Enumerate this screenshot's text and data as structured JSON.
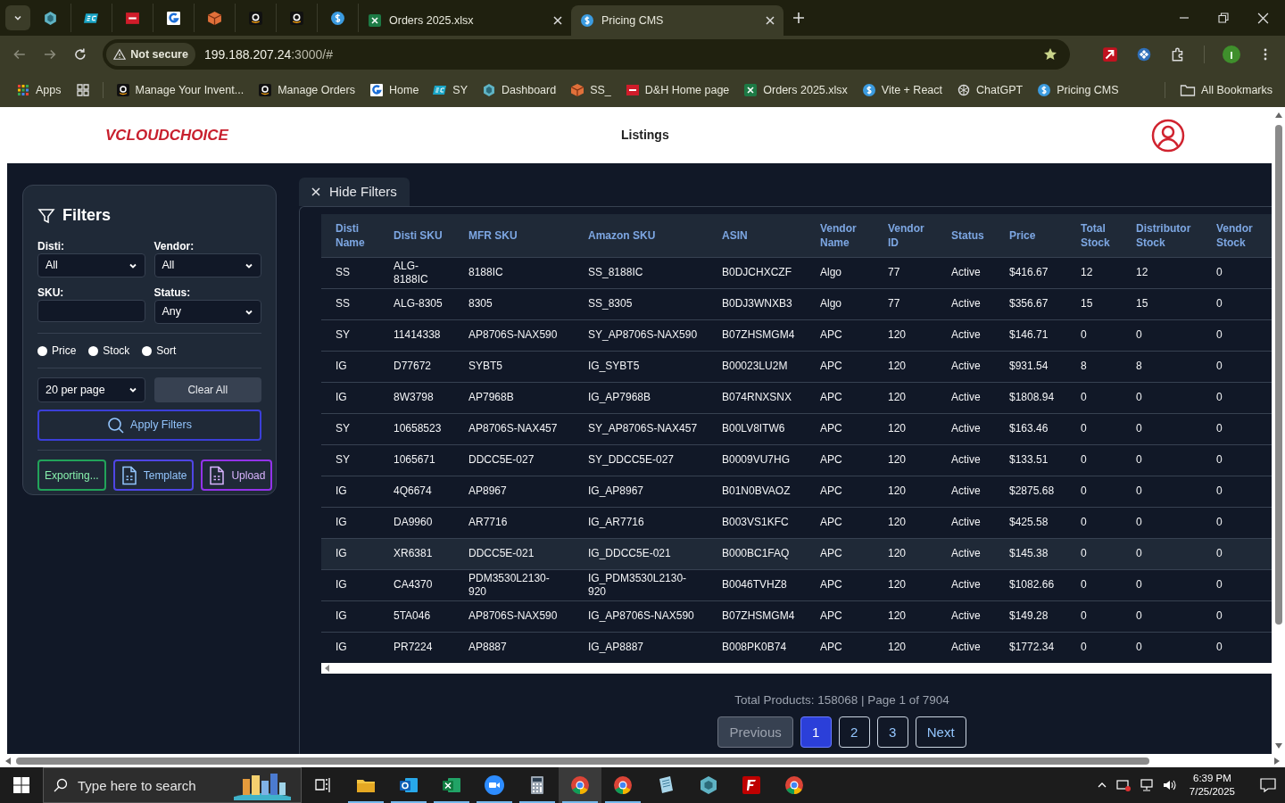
{
  "browser": {
    "tabs": [
      {
        "kind": "sheet",
        "title": "Orders 2025.xlsx",
        "selected": false
      },
      {
        "kind": "dollar",
        "title": "Pricing CMS",
        "selected": true
      }
    ],
    "address": {
      "warning": "Not secure",
      "host": "199.188.207.24",
      "path": ":3000/#"
    },
    "bookmarks": [
      {
        "kind": "apps",
        "label": "Apps"
      },
      {
        "kind": "amazon",
        "label": "Manage Your Invent..."
      },
      {
        "kind": "amazon",
        "label": "Manage Orders"
      },
      {
        "kind": "g",
        "label": "Home"
      },
      {
        "kind": "ec",
        "label": "SY"
      },
      {
        "kind": "hex",
        "label": "Dashboard"
      },
      {
        "kind": "box",
        "label": "SS_"
      },
      {
        "kind": "dh",
        "label": "D&H Home page"
      },
      {
        "kind": "sheet",
        "label": "Orders 2025.xlsx"
      },
      {
        "kind": "dollar",
        "label": "Vite + React"
      },
      {
        "kind": "openai",
        "label": "ChatGPT"
      },
      {
        "kind": "dollar",
        "label": "Pricing CMS"
      }
    ],
    "all_bookmarks": "All Bookmarks"
  },
  "app": {
    "logo": "VCLOUDCHOICE",
    "title": "Listings"
  },
  "filters": {
    "title": "Filters",
    "fields": [
      {
        "kind": "select",
        "label": "Disti:",
        "value": "All"
      },
      {
        "kind": "select",
        "label": "Vendor:",
        "value": "All"
      },
      {
        "kind": "input",
        "label": "SKU:"
      },
      {
        "kind": "select",
        "label": "Status:",
        "value": "Any"
      }
    ],
    "radios": [
      {
        "label": "Price",
        "checked": false
      },
      {
        "label": "Stock",
        "checked": false
      },
      {
        "label": "Sort",
        "checked": false
      }
    ],
    "per_page": "20 per page",
    "clear": "Clear All",
    "apply": "Apply Filters",
    "actions": [
      {
        "kind": "plain",
        "label": "Exporting...",
        "color": "#22a35a"
      },
      {
        "kind": "file",
        "label": "Template",
        "color": "#4f46e5"
      },
      {
        "kind": "file",
        "label": "Upload",
        "color": "#9333ea"
      }
    ]
  },
  "hide_filters": "Hide Filters",
  "table": {
    "columns": [
      "Disti Name",
      "Disti SKU",
      "MFR SKU",
      "Amazon SKU",
      "ASIN",
      "Vendor Name",
      "Vendor ID",
      "Status",
      "Price",
      "Total Stock",
      "Distributor Stock",
      "Vendor Stock"
    ],
    "rows": [
      {
        "selected": false,
        "cells": [
          "SS",
          "ALG-8188IC",
          "8188IC",
          "SS_8188IC",
          "B0DJCHXCZF",
          "Algo",
          "77",
          "Active",
          "$416.67",
          "12",
          "12",
          "0"
        ]
      },
      {
        "selected": false,
        "cells": [
          "SS",
          "ALG-8305",
          "8305",
          "SS_8305",
          "B0DJ3WNXB3",
          "Algo",
          "77",
          "Active",
          "$356.67",
          "15",
          "15",
          "0"
        ]
      },
      {
        "selected": false,
        "cells": [
          "SY",
          "11414338",
          "AP8706S-NAX590",
          "SY_AP8706S-NAX590",
          "B07ZHSMGM4",
          "APC",
          "120",
          "Active",
          "$146.71",
          "0",
          "0",
          "0"
        ]
      },
      {
        "selected": false,
        "cells": [
          "IG",
          "D77672",
          "SYBT5",
          "IG_SYBT5",
          "B00023LU2M",
          "APC",
          "120",
          "Active",
          "$931.54",
          "8",
          "8",
          "0"
        ]
      },
      {
        "selected": false,
        "cells": [
          "IG",
          "8W3798",
          "AP7968B",
          "IG_AP7968B",
          "B074RNXSNX",
          "APC",
          "120",
          "Active",
          "$1808.94",
          "0",
          "0",
          "0"
        ]
      },
      {
        "selected": false,
        "cells": [
          "SY",
          "10658523",
          "AP8706S-NAX457",
          "SY_AP8706S-NAX457",
          "B00LV8ITW6",
          "APC",
          "120",
          "Active",
          "$163.46",
          "0",
          "0",
          "0"
        ]
      },
      {
        "selected": false,
        "cells": [
          "SY",
          "1065671",
          "DDCC5E-027",
          "SY_DDCC5E-027",
          "B0009VU7HG",
          "APC",
          "120",
          "Active",
          "$133.51",
          "0",
          "0",
          "0"
        ]
      },
      {
        "selected": false,
        "cells": [
          "IG",
          "4Q6674",
          "AP8967",
          "IG_AP8967",
          "B01N0BVAOZ",
          "APC",
          "120",
          "Active",
          "$2875.68",
          "0",
          "0",
          "0"
        ]
      },
      {
        "selected": false,
        "cells": [
          "IG",
          "DA9960",
          "AR7716",
          "IG_AR7716",
          "B003VS1KFC",
          "APC",
          "120",
          "Active",
          "$425.58",
          "0",
          "0",
          "0"
        ]
      },
      {
        "selected": true,
        "cells": [
          "IG",
          "XR6381",
          "DDCC5E-021",
          "IG_DDCC5E-021",
          "B000BC1FAQ",
          "APC",
          "120",
          "Active",
          "$145.38",
          "0",
          "0",
          "0"
        ]
      },
      {
        "selected": false,
        "cells": [
          "IG",
          "CA4370",
          "PDM3530L2130-920",
          "IG_PDM3530L2130-920",
          "B0046TVHZ8",
          "APC",
          "120",
          "Active",
          "$1082.66",
          "0",
          "0",
          "0"
        ]
      },
      {
        "selected": false,
        "cells": [
          "IG",
          "5TA046",
          "AP8706S-NAX590",
          "IG_AP8706S-NAX590",
          "B07ZHSMGM4",
          "APC",
          "120",
          "Active",
          "$149.28",
          "0",
          "0",
          "0"
        ]
      },
      {
        "selected": false,
        "cells": [
          "IG",
          "PR7224",
          "AP8887",
          "IG_AP8887",
          "B008PK0B74",
          "APC",
          "120",
          "Active",
          "$1772.34",
          "0",
          "0",
          "0"
        ]
      }
    ]
  },
  "pagination": {
    "summary": "Total Products: 158068 | Page 1 of 7904",
    "buttons": [
      {
        "kind": "nav",
        "label": "Previous",
        "disabled": true,
        "selected": false
      },
      {
        "kind": "page",
        "label": "1",
        "disabled": false,
        "selected": true
      },
      {
        "kind": "page",
        "label": "2",
        "disabled": false,
        "selected": false
      },
      {
        "kind": "page",
        "label": "3",
        "disabled": false,
        "selected": false
      },
      {
        "kind": "nav",
        "label": "Next",
        "disabled": false,
        "selected": false
      }
    ]
  },
  "taskbar": {
    "search_placeholder": "Type here to search",
    "apps": [
      {
        "kind": "explorer",
        "running": true,
        "selected": false
      },
      {
        "kind": "outlook",
        "running": true,
        "selected": false
      },
      {
        "kind": "excel",
        "running": true,
        "selected": false
      },
      {
        "kind": "zoom",
        "running": true,
        "selected": false
      },
      {
        "kind": "calculator",
        "running": true,
        "selected": false
      },
      {
        "kind": "chrome",
        "running": true,
        "selected": true
      },
      {
        "kind": "chrome",
        "running": true,
        "selected": false
      },
      {
        "kind": "notes",
        "running": false,
        "selected": false
      },
      {
        "kind": "hex",
        "running": false,
        "selected": false
      },
      {
        "kind": "filezilla",
        "running": false,
        "selected": false
      },
      {
        "kind": "chrome",
        "running": false,
        "selected": false
      }
    ],
    "time": "6:39 PM",
    "date": "7/25/2025"
  }
}
